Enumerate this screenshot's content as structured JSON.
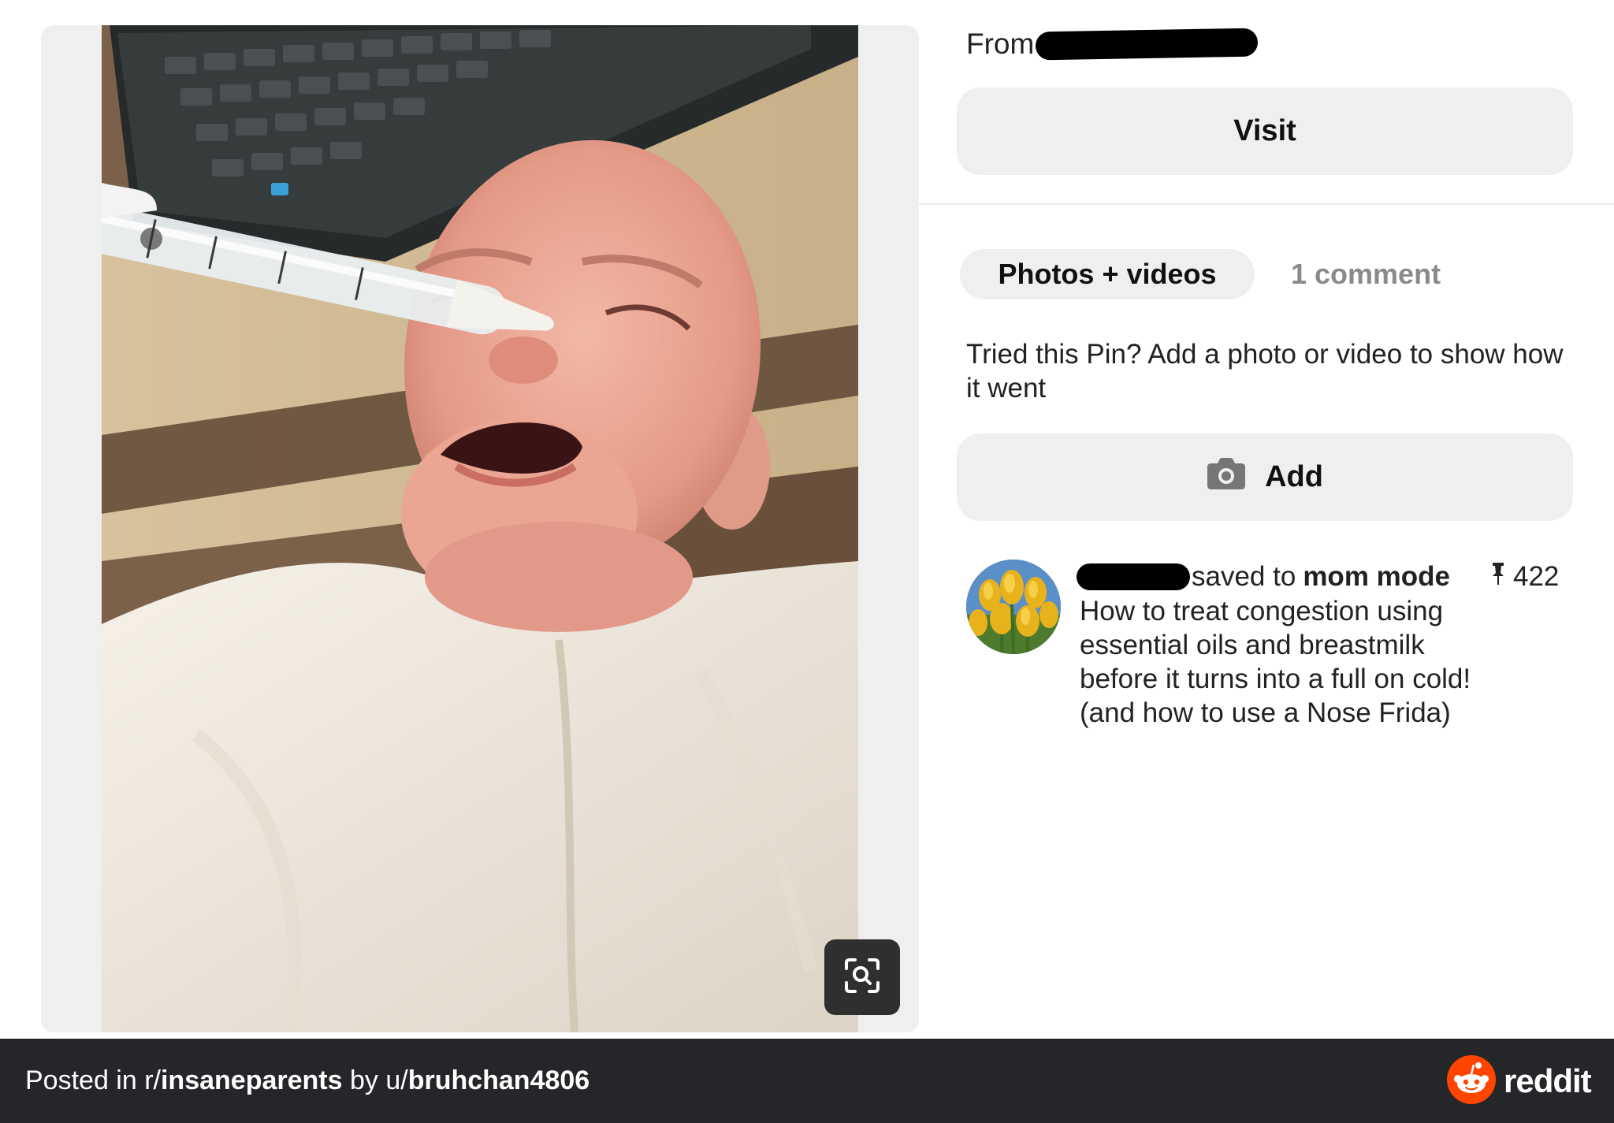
{
  "pin": {
    "from_label": "From",
    "visit_label": "Visit"
  },
  "tabs": {
    "photos_videos": "Photos + videos",
    "comments": "1 comment"
  },
  "tried": {
    "prompt": "Tried this Pin? Add a photo or video to show how it went",
    "add_label": "Add"
  },
  "activity": {
    "saved_to_label": "saved to",
    "board_name": "mom mode",
    "pin_count": "422",
    "description": "How to treat congestion using essential oils and breastmilk before it turns into a full on cold! (and how to use a Nose Frida)"
  },
  "footer": {
    "posted_in": "Posted in r/",
    "subreddit": "insaneparents",
    "by": " by u/",
    "username": "bruhchan4806",
    "brand": "reddit"
  },
  "icons": {
    "lens": "visual-search-icon",
    "camera": "camera-icon",
    "pin": "pushpin-icon",
    "reddit": "reddit-snoo-icon"
  },
  "colors": {
    "button_bg": "#efefef",
    "footer_bg": "#242629",
    "reddit_orange": "#ff4500",
    "muted_text": "#8a8a8a"
  }
}
